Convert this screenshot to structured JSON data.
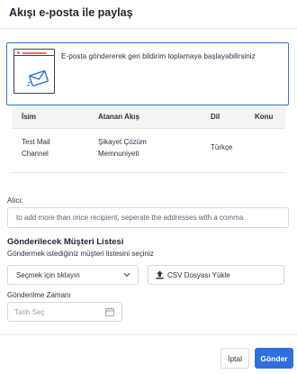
{
  "dialog": {
    "title": "Akışı e-posta ile paylaş"
  },
  "banner": {
    "text": "E-posta göndererek geri bildirim toplamaya başlayabilirsiniz",
    "icon": "email-illustration-icon"
  },
  "table": {
    "headers": [
      "İsim",
      "Atanan Akış",
      "Dil",
      "Konu"
    ],
    "rows": [
      {
        "name_line1": "Test Mail",
        "name_line2": "Channel",
        "flow_line1": "Şikayet Çözüm",
        "flow_line2": "Memnuniyeti",
        "language": "Türkçe",
        "subject": ""
      }
    ]
  },
  "recipients": {
    "label": "Alıcı:",
    "placeholder": "to add more than once recipient, seperate the addresses with a comma"
  },
  "customer_list": {
    "title": "Gönderilecek Müşteri Listesi",
    "subtitle": "Göndermek istediğiniz müşteri listesini seçiniz",
    "select_placeholder": "Seçmek için tıklayın",
    "upload_label": "CSV Dosyası Yükle"
  },
  "schedule": {
    "label": "Gönderilme Zamanı",
    "placeholder": "Tarih Seç"
  },
  "footer": {
    "cancel_label": "İptal",
    "send_label": "Gönder"
  },
  "colors": {
    "accent": "#2f6fde",
    "illustration_red": "#ec6b5e"
  }
}
